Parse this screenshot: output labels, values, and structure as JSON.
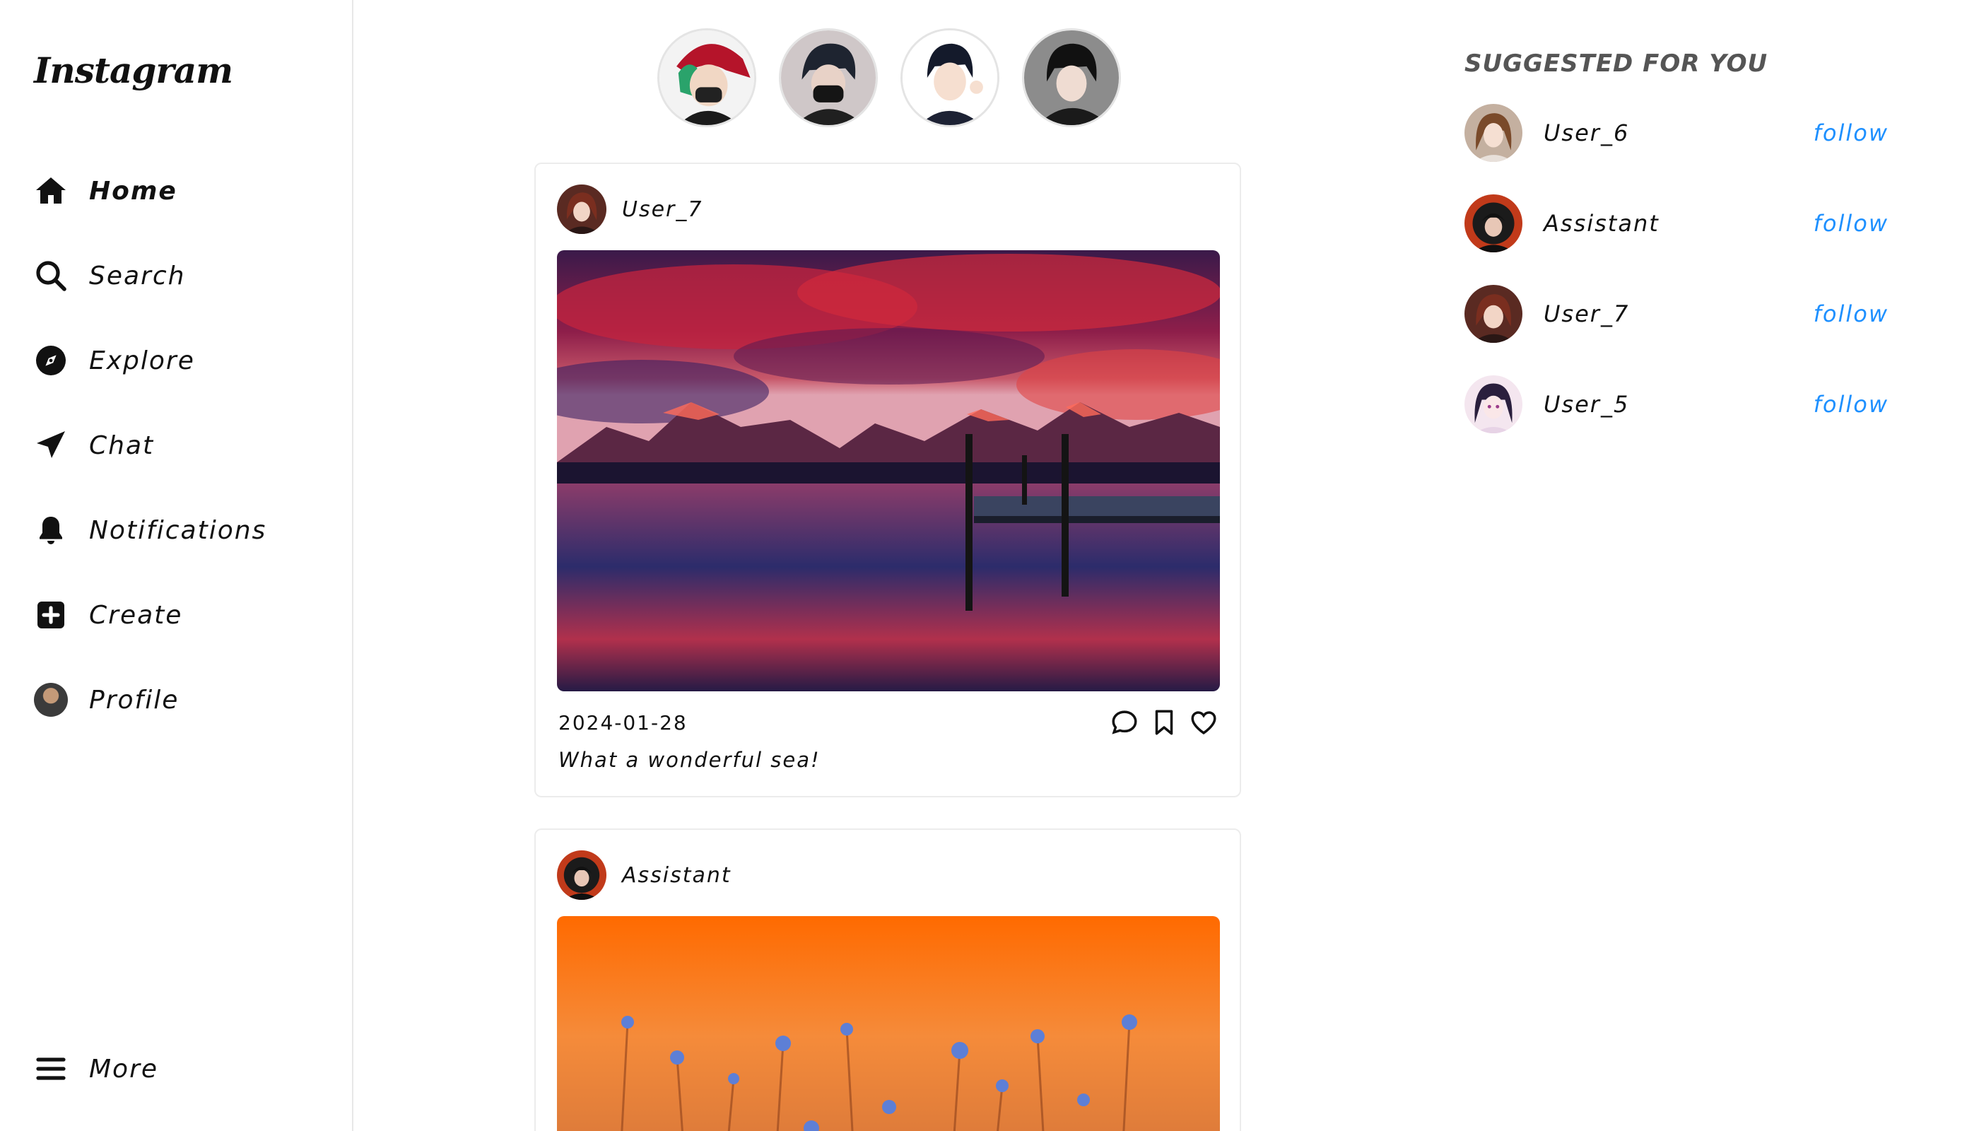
{
  "brand": {
    "logo_text": "Instagram"
  },
  "sidebar": {
    "items": [
      {
        "label": "Home",
        "icon": "home-icon",
        "active": true
      },
      {
        "label": "Search",
        "icon": "search-icon"
      },
      {
        "label": "Explore",
        "icon": "compass-icon"
      },
      {
        "label": "Chat",
        "icon": "send-icon"
      },
      {
        "label": "Notifications",
        "icon": "bell-icon"
      },
      {
        "label": "Create",
        "icon": "plus-square-icon"
      },
      {
        "label": "Profile",
        "icon": "profile-avatar"
      }
    ],
    "more_label": "More"
  },
  "stories": [
    {
      "avatar": "story-avatar-1"
    },
    {
      "avatar": "story-avatar-2"
    },
    {
      "avatar": "story-avatar-3"
    },
    {
      "avatar": "story-avatar-4"
    }
  ],
  "posts": [
    {
      "user": "User_7",
      "image": "mountain-lake-sunset",
      "date": "2024-01-28",
      "caption": "What a wonderful sea!"
    },
    {
      "user": "Assistant",
      "image": "orange-field-flowers"
    }
  ],
  "suggestions": {
    "title": "SUGGESTED FOR YOU",
    "follow_label": "follow",
    "users": [
      {
        "name": "User_6"
      },
      {
        "name": "Assistant"
      },
      {
        "name": "User_7"
      },
      {
        "name": "User_5"
      }
    ]
  },
  "colors": {
    "accent_follow": "#1e90ff",
    "border": "#ececec",
    "text": "#111111"
  }
}
